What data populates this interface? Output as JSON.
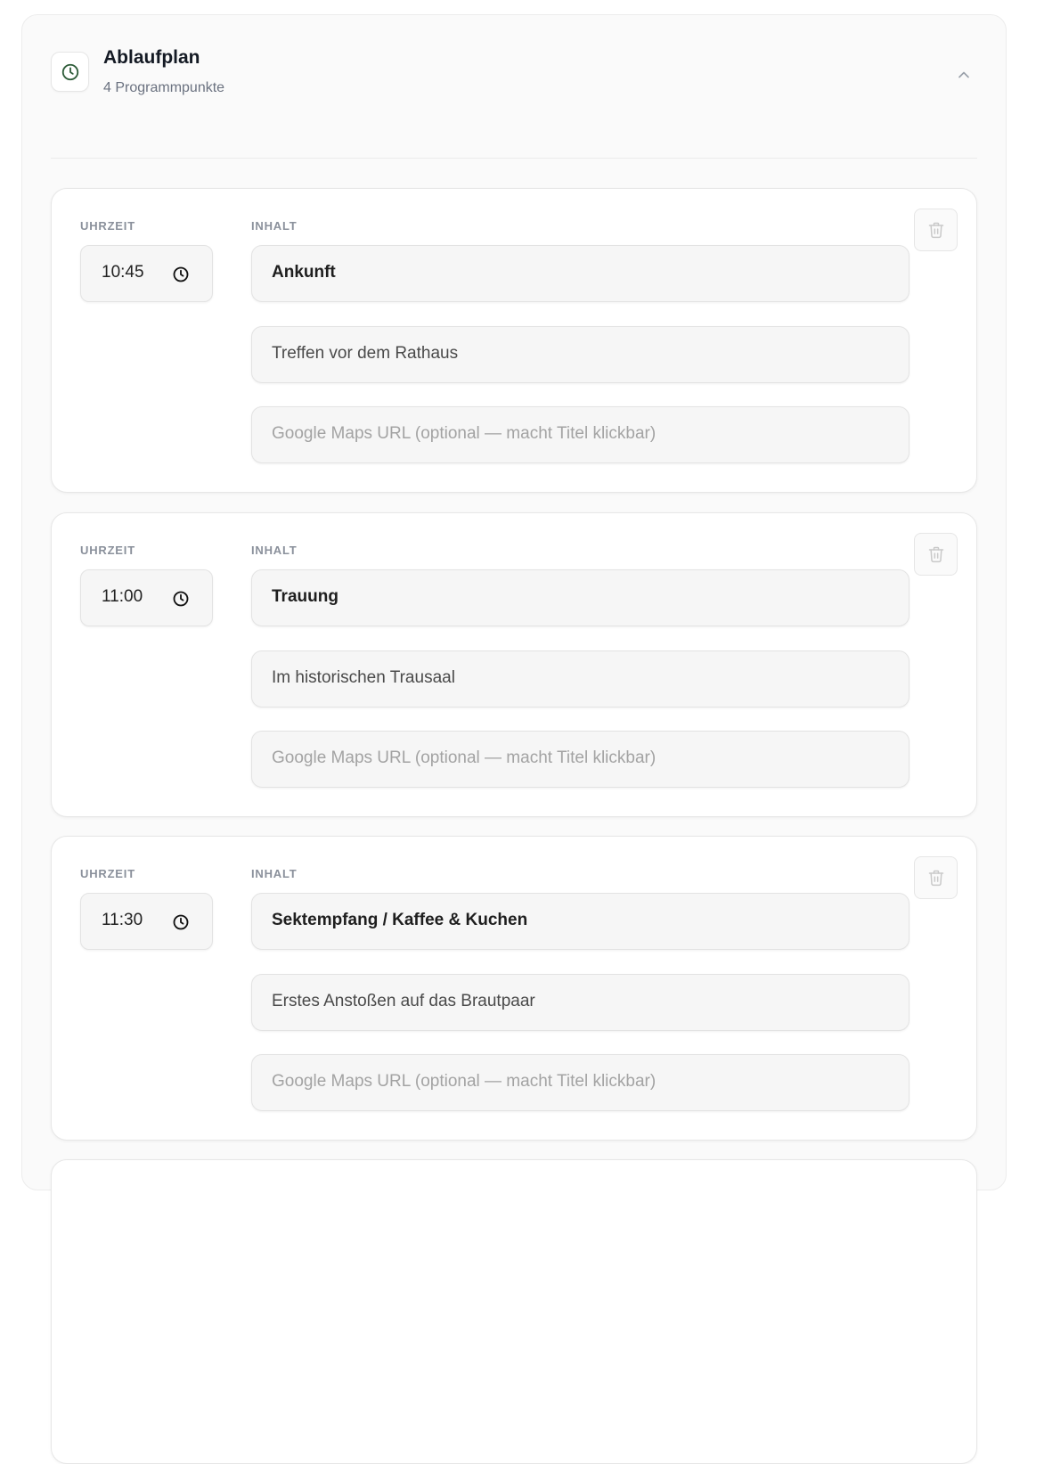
{
  "section": {
    "title": "Ablaufplan",
    "subtitle": "4 Programmpunkte",
    "icon": "clock-icon",
    "accent_color": "#2f5d3a"
  },
  "labels": {
    "time": "UHRZEIT",
    "content": "INHALT"
  },
  "items": [
    {
      "time": "10:45",
      "title": "Ankunft",
      "description": "Treffen vor dem Rathaus",
      "maps_url_placeholder": "Google Maps URL (optional — macht Titel klickbar)"
    },
    {
      "time": "11:00",
      "title": "Trauung",
      "description": "Im historischen Trausaal",
      "maps_url_placeholder": "Google Maps URL (optional — macht Titel klickbar)"
    },
    {
      "time": "11:30",
      "title": "Sektempfang / Kaffee & Kuchen",
      "description": "Erstes Anstoßen auf das Brautpaar",
      "maps_url_placeholder": "Google Maps URL (optional — macht Titel klickbar)"
    }
  ]
}
